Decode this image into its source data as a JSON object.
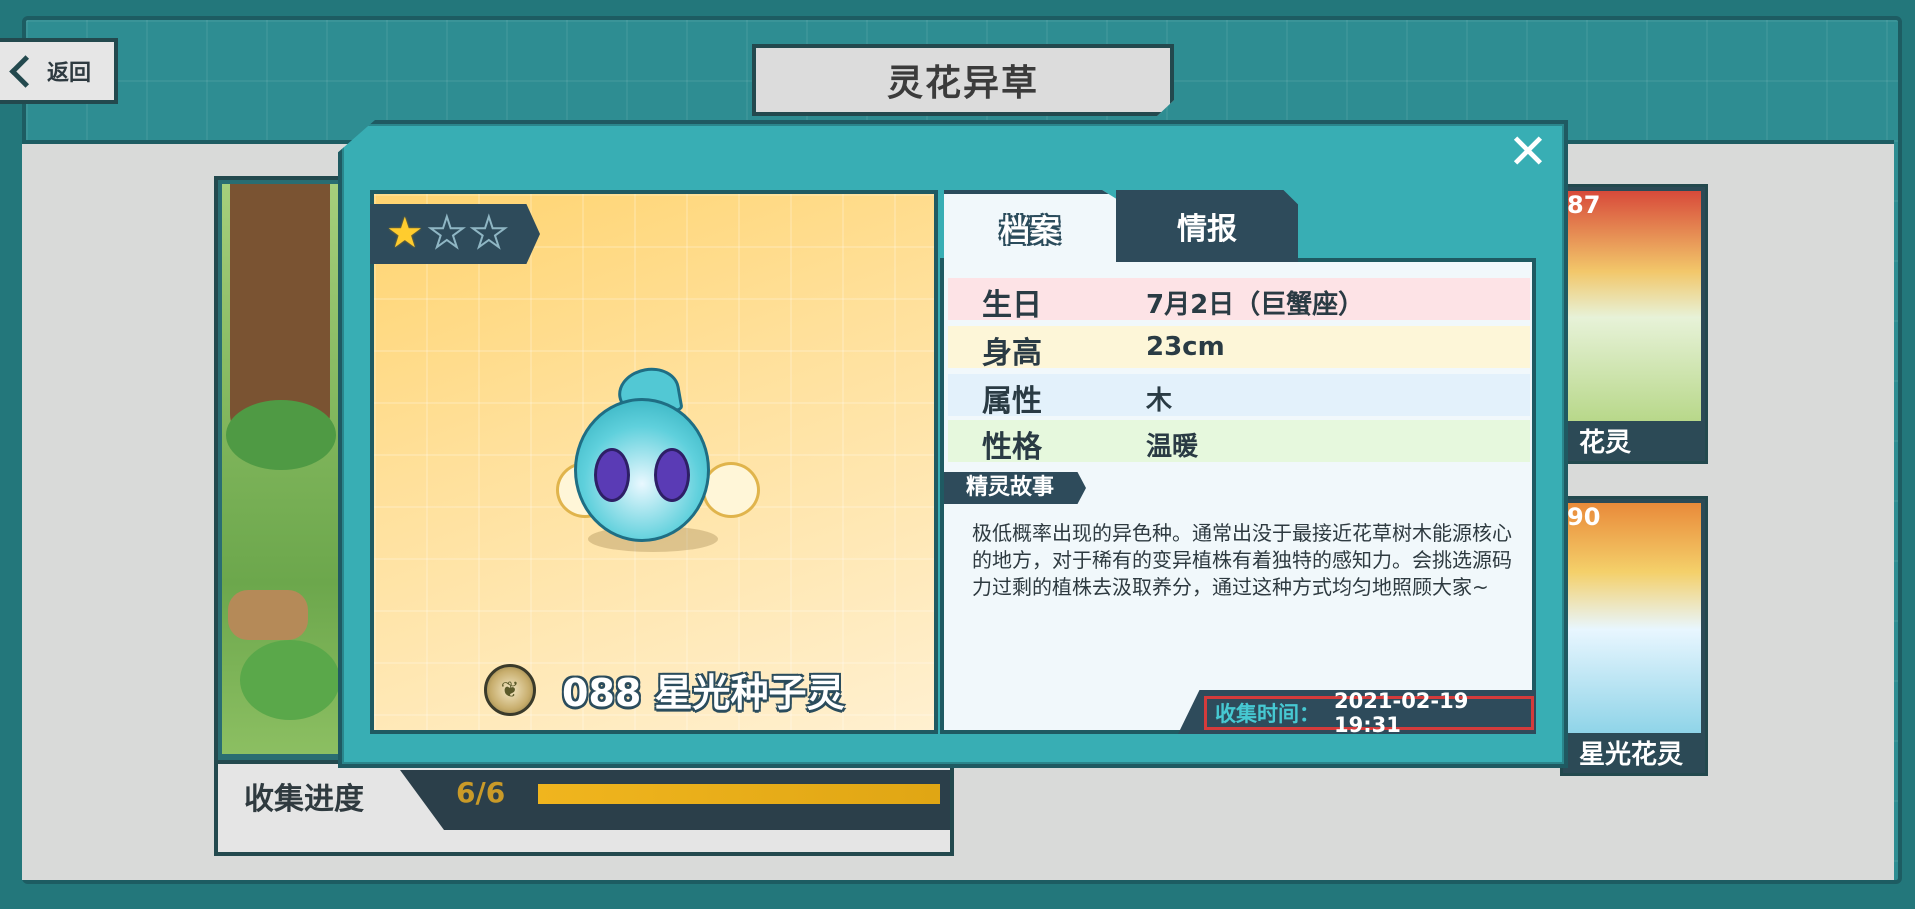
{
  "header": {
    "back_label": "返回",
    "title": "灵花异草"
  },
  "background": {
    "progress_label": "收集进度",
    "progress_count": "6/6",
    "progress_fraction": 1.0,
    "side_cards": [
      {
        "number": "87",
        "label": "花灵"
      },
      {
        "number": "90",
        "label": "星光花灵"
      }
    ]
  },
  "modal": {
    "stars_total": 3,
    "stars_filled": 1,
    "creature_name": "088 星光种子灵",
    "element_icon": "leaf-icon",
    "tabs": [
      {
        "label": "档案",
        "active": true
      },
      {
        "label": "情报",
        "active": false
      }
    ],
    "profile": [
      {
        "key": "生日",
        "value": "7月2日（巨蟹座）",
        "color": "#fde3e6"
      },
      {
        "key": "身高",
        "value": "23cm",
        "color": "#fdf6d8"
      },
      {
        "key": "属性",
        "value": "木",
        "color": "#e3f1fb"
      },
      {
        "key": "性格",
        "value": "温暖",
        "color": "#e6f8dd"
      }
    ],
    "story_title": "精灵故事",
    "story": "极低概率出现的异色种。通常出没于最接近花草树木能源核心的地方，对于稀有的变异植株有着独特的感知力。会挑选源码力过剩的植株去汲取养分，通过这种方式均匀地照顾大家~",
    "collect_label": "收集时间：",
    "collect_value": "2021-02-19 19:31"
  }
}
